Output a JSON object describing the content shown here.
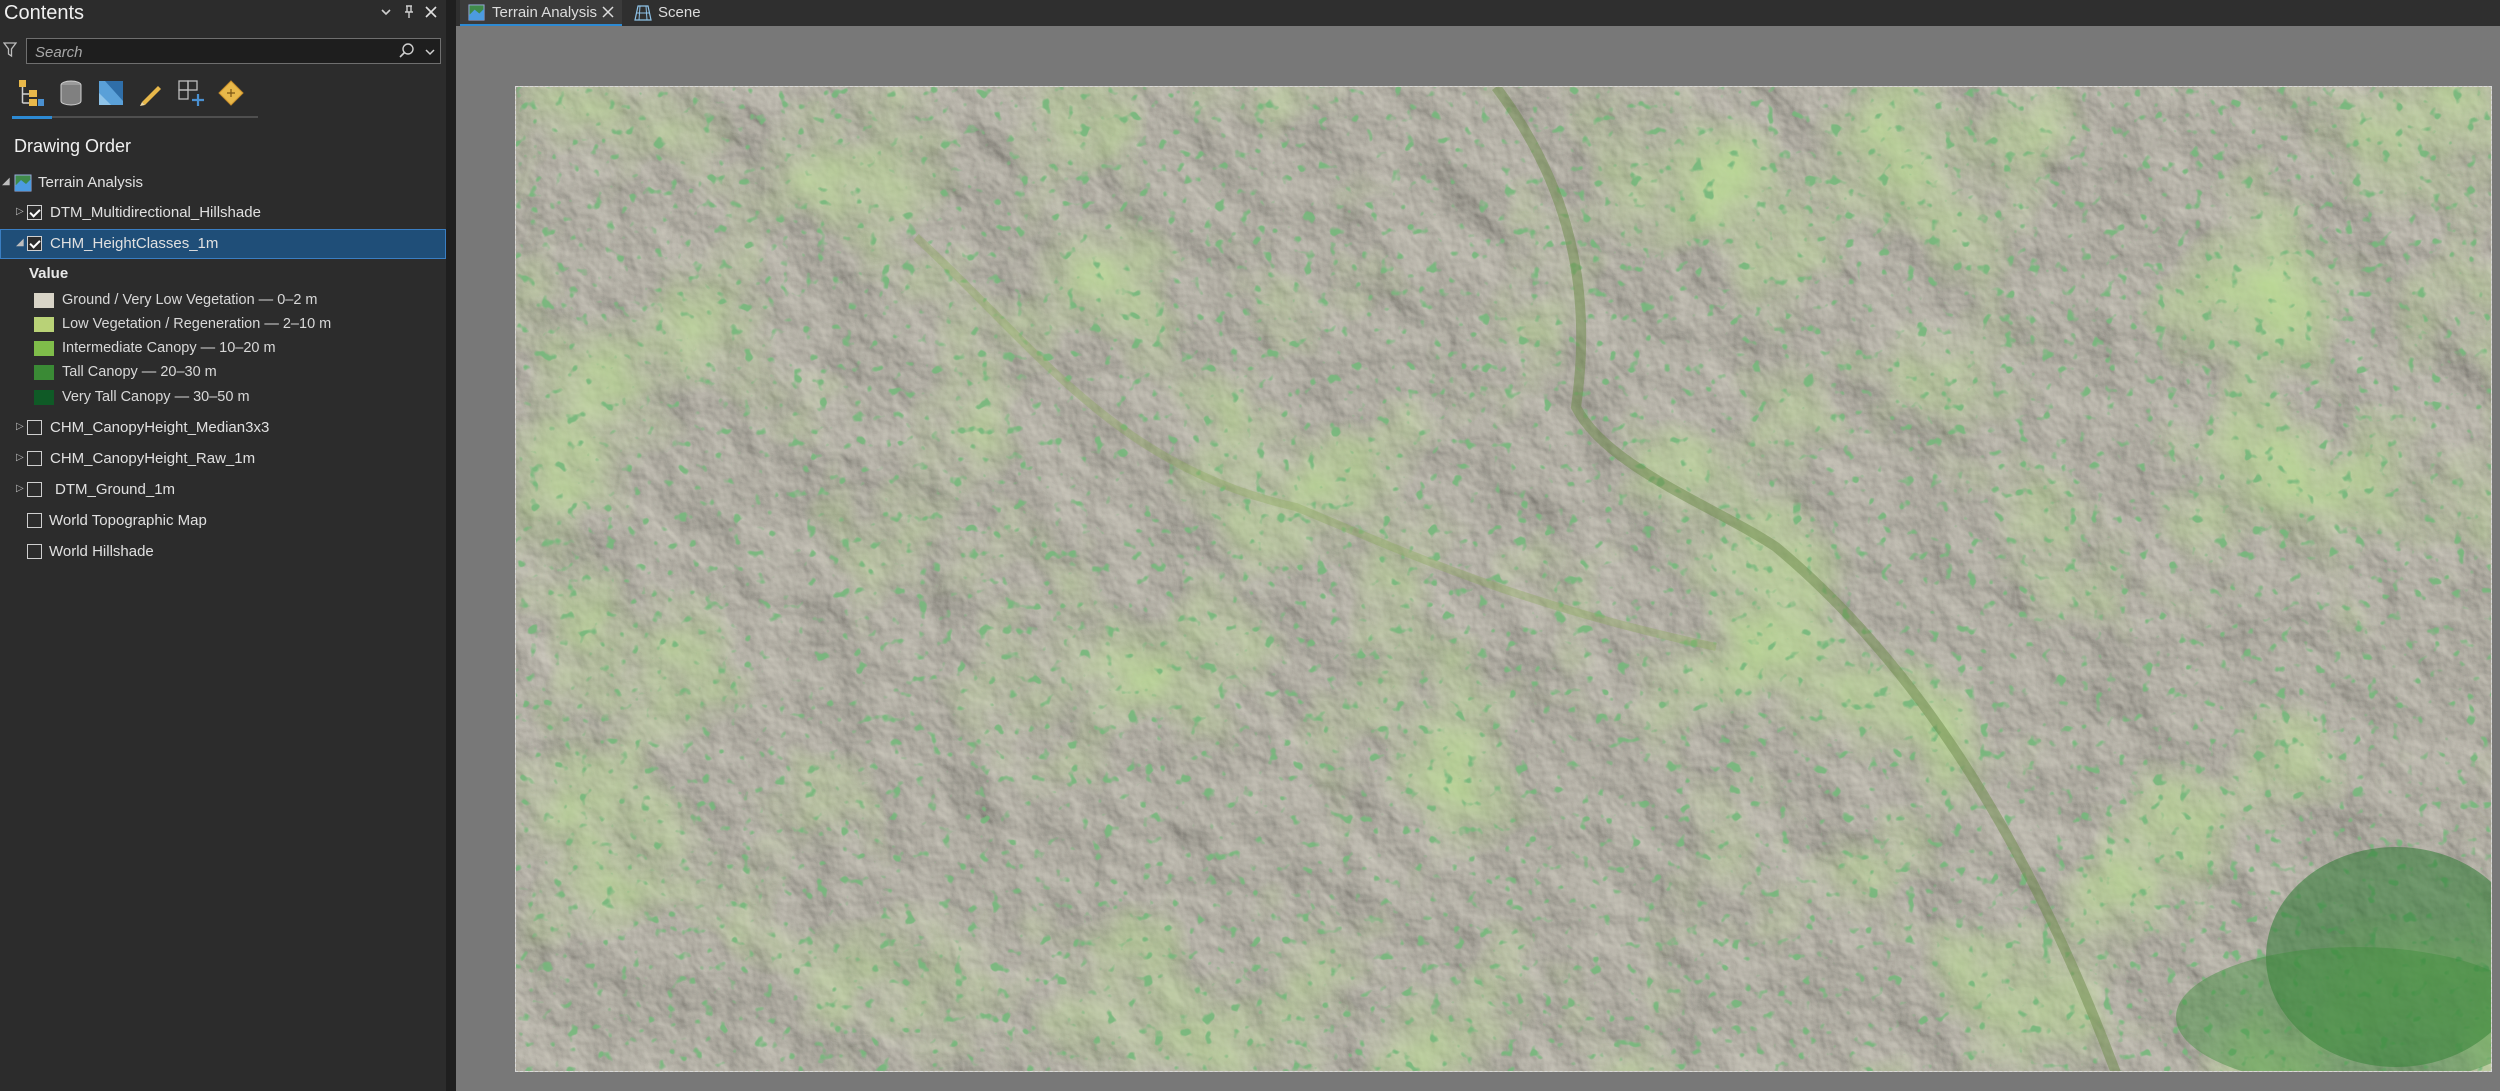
{
  "contents_pane": {
    "title": "Contents",
    "controls": {
      "dropdown_icon": "chevron-down-icon",
      "pin_icon": "pin-icon",
      "close_icon": "close-icon"
    },
    "search": {
      "placeholder": "Search"
    },
    "toolbar_icons": [
      "list-by-drawing-order-icon",
      "list-by-source-icon",
      "list-by-selection-icon",
      "list-by-editing-icon",
      "list-by-snapping-icon",
      "list-by-labeling-icon"
    ],
    "drawing_order_heading": "Drawing Order",
    "map_name": "Terrain Analysis",
    "layers": [
      {
        "name": "DTM_Multidirectional_Hillshade",
        "checked": true,
        "expandable": true,
        "selected": false
      },
      {
        "name": "CHM_HeightClasses_1m",
        "checked": true,
        "expandable": true,
        "expanded": true,
        "selected": true
      },
      {
        "name": "CHM_CanopyHeight_Median3x3",
        "checked": false,
        "expandable": true,
        "selected": false
      },
      {
        "name": "CHM_CanopyHeight_Raw_1m",
        "checked": false,
        "expandable": true,
        "selected": false
      },
      {
        "name": "DTM_Ground_1m",
        "checked": false,
        "expandable": true,
        "selected": false
      },
      {
        "name": "World Topographic Map",
        "checked": false,
        "expandable": false,
        "selected": false
      },
      {
        "name": "World Hillshade",
        "checked": false,
        "expandable": false,
        "selected": false
      }
    ],
    "legend": {
      "heading": "Value",
      "classes": [
        {
          "label": "Ground / Very Low Vegetation — 0–2 m",
          "color": "#d8d4c7"
        },
        {
          "label": "Low Vegetation / Regeneration — 2–10 m",
          "color": "#b9d277"
        },
        {
          "label": "Intermediate Canopy — 10–20 m",
          "color": "#7fbd4a"
        },
        {
          "label": "Tall Canopy — 20–30 m",
          "color": "#3a8a35"
        },
        {
          "label": "Very Tall Canopy — 30–50 m",
          "color": "#0f5a26"
        }
      ]
    }
  },
  "tabs": [
    {
      "label": "Terrain Analysis",
      "active": true,
      "icon": "map-icon",
      "closable": true
    },
    {
      "label": "Scene",
      "active": false,
      "icon": "scene-icon",
      "closable": false
    }
  ],
  "colors": {
    "accent": "#2d8ad3",
    "selection": "#1f4e78",
    "map_background": "#787878",
    "terrain_base": "#cfcbbf"
  }
}
